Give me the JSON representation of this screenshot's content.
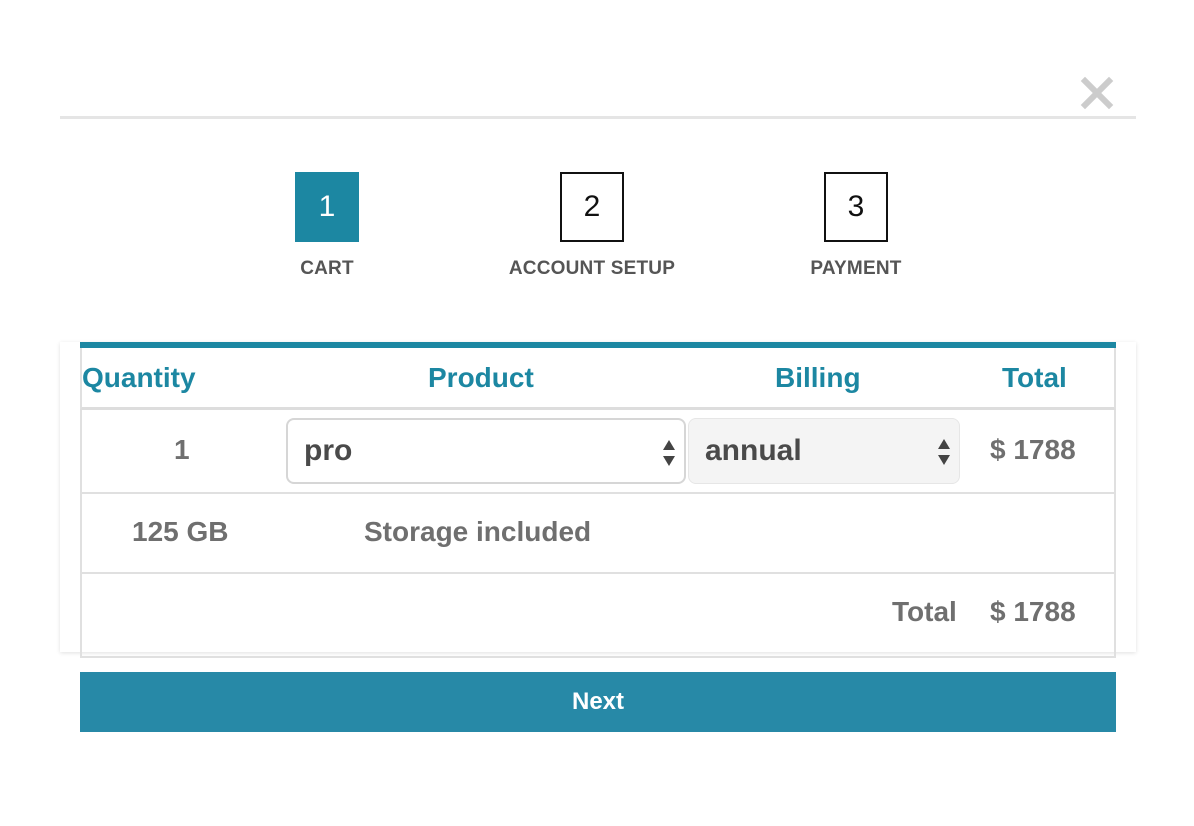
{
  "modal": {
    "close_icon": "close-icon"
  },
  "steps": [
    {
      "number": "1",
      "label": "CART",
      "active": true
    },
    {
      "number": "2",
      "label": "ACCOUNT SETUP",
      "active": false
    },
    {
      "number": "3",
      "label": "PAYMENT",
      "active": false
    }
  ],
  "table": {
    "headers": {
      "quantity": "Quantity",
      "product": "Product",
      "billing": "Billing",
      "total": "Total"
    },
    "item_row": {
      "quantity": "1",
      "product_selected": "pro",
      "billing_selected": "annual",
      "total": "$ 1788"
    },
    "storage_row": {
      "amount": "125 GB",
      "description": "Storage included"
    },
    "total_row": {
      "label": "Total",
      "value": "$ 1788"
    }
  },
  "actions": {
    "next_label": "Next"
  },
  "colors": {
    "accent": "#1c87a2",
    "button": "#2789a7",
    "muted_text": "#6f6f6f"
  }
}
